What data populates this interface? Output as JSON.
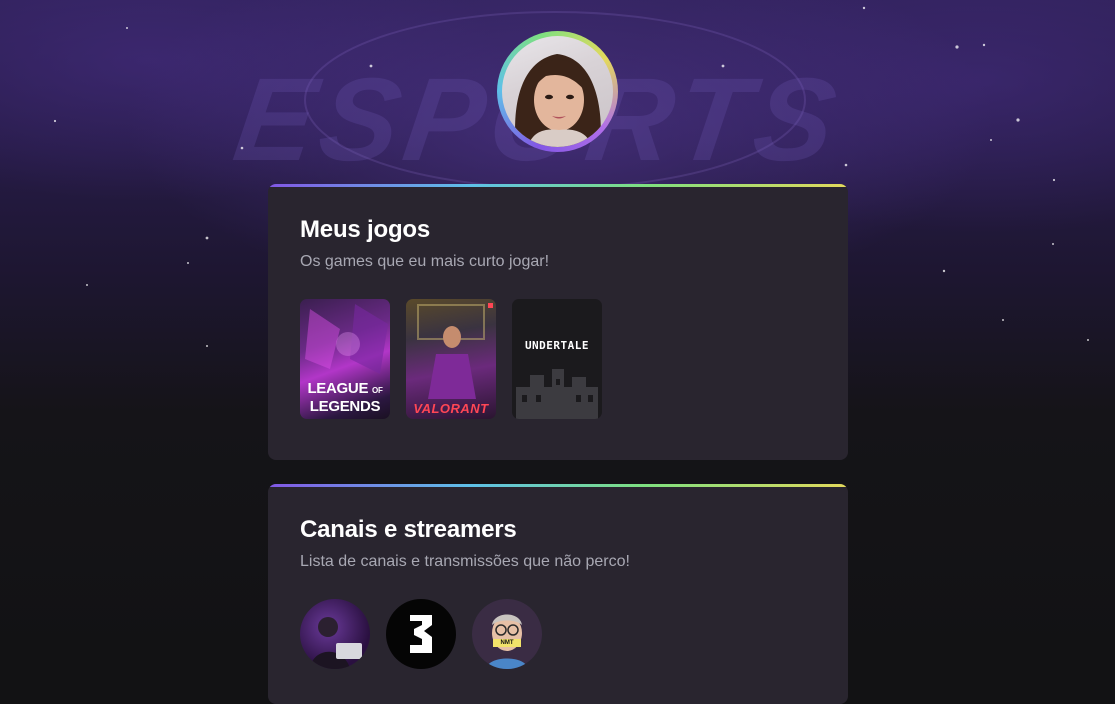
{
  "profile": {
    "avatar_alt": "Foto de perfil"
  },
  "games": {
    "title": "Meus jogos",
    "subtitle": "Os games que eu mais curto jogar!",
    "items": [
      {
        "name": "League of Legends",
        "label_line1": "LEAGUE",
        "label_of": "OF",
        "label_line2": "LEGENDS"
      },
      {
        "name": "Valorant",
        "label": "VALORANT"
      },
      {
        "name": "Undertale",
        "label": "UNDERTALE"
      }
    ]
  },
  "channels": {
    "title": "Canais e streamers",
    "subtitle": "Lista de canais e transmissões que não perco!",
    "items": [
      {
        "name": "streamer-1"
      },
      {
        "name": "streamer-2"
      },
      {
        "name": "streamer-3",
        "badge": "NMT"
      }
    ]
  },
  "colors": {
    "card_background": "#29252f",
    "accent_gradient": [
      "#8257e5",
      "#5ec1e8",
      "#7ee080",
      "#e3d95c"
    ],
    "title_text": "#ffffff",
    "subtitle_text": "#a8a8b3"
  }
}
